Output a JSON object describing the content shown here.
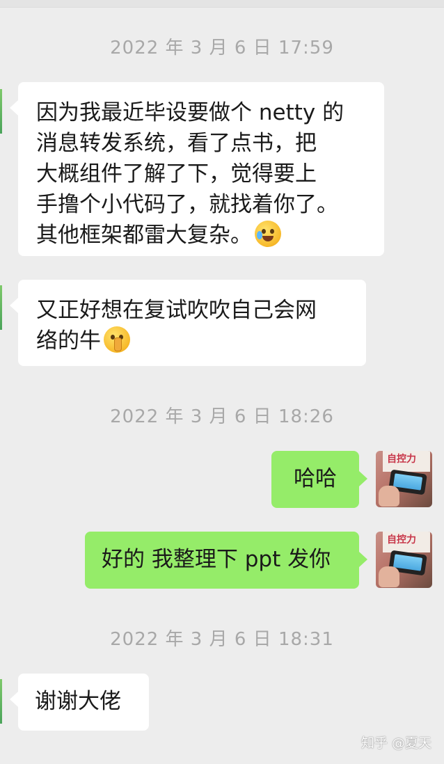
{
  "messages": [
    {
      "type": "timestamp",
      "text": "2022 年 3 月 6 日 17:59"
    },
    {
      "type": "incoming",
      "lines": [
        "因为我最近毕设要做个 netty 的",
        "消息转发系统，看了点书，把",
        "大概组件了解了下，觉得要上",
        "手撸个小代码了，就找着你了。",
        "其他框架都雷大复杂。"
      ],
      "emoji": "crying-face-emoji"
    },
    {
      "type": "incoming",
      "lines": [
        "又正好想在复试吹吹自己会网",
        "络的牛"
      ],
      "emoji": "shushing-face-emoji"
    },
    {
      "type": "timestamp",
      "text": "2022 年 3 月 6 日 18:26"
    },
    {
      "type": "outgoing",
      "text": "哈哈"
    },
    {
      "type": "outgoing",
      "text": "好的 我整理下 ppt 发你"
    },
    {
      "type": "timestamp",
      "text": "2022 年 3 月 6 日 18:31"
    },
    {
      "type": "incoming",
      "lines": [
        "谢谢大佬"
      ]
    }
  ],
  "avatar": {
    "book_text": "自控力"
  },
  "watermark": "知乎 @夏天",
  "colors": {
    "background": "#ededed",
    "incoming_bubble": "#ffffff",
    "outgoing_bubble": "#95ec69",
    "timestamp": "#a8a8a8"
  }
}
